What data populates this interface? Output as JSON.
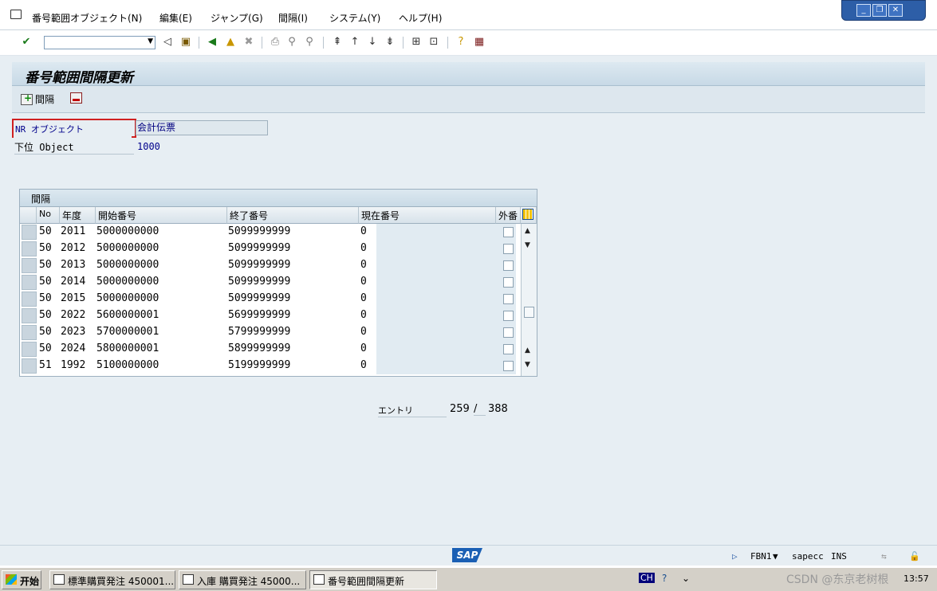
{
  "menubar": {
    "items": [
      "番号範囲オブジェクト(N)",
      "編集(E)",
      "ジャンプ(G)",
      "間隔(I)",
      "システム(Y)",
      "ヘルプ(H)"
    ]
  },
  "toolbar": {
    "command_value": "",
    "icons": [
      "enter-icon",
      "back-icon",
      "save-icon",
      "back-arrow-icon",
      "exit-icon",
      "cancel-icon",
      "print-icon",
      "find-icon",
      "find-next-icon",
      "first-page-icon",
      "prev-page-icon",
      "next-page-icon",
      "last-page-icon",
      "new-session-icon",
      "shortcut-icon",
      "help-icon",
      "layout-icon"
    ]
  },
  "screen": {
    "title": "番号範囲間隔更新",
    "app_button_label": "間隔"
  },
  "fields": {
    "nr_object_label": "NR オブジェクト",
    "nr_object_value": "会計伝票",
    "sub_object_label": "下位 Object",
    "sub_object_value": "1000"
  },
  "table": {
    "title": "間隔",
    "headers": [
      "No",
      "年度",
      "開始番号",
      "終了番号",
      "現在番号",
      "外番"
    ],
    "rows": [
      [
        "50",
        "2011",
        "5000000000",
        "5099999999",
        "0"
      ],
      [
        "50",
        "2012",
        "5000000000",
        "5099999999",
        "0"
      ],
      [
        "50",
        "2013",
        "5000000000",
        "5099999999",
        "0"
      ],
      [
        "50",
        "2014",
        "5000000000",
        "5099999999",
        "0"
      ],
      [
        "50",
        "2015",
        "5000000000",
        "5099999999",
        "0"
      ],
      [
        "50",
        "2022",
        "5600000001",
        "5699999999",
        "0"
      ],
      [
        "50",
        "2023",
        "5700000001",
        "5799999999",
        "0"
      ],
      [
        "50",
        "2024",
        "5800000001",
        "5899999999",
        "0"
      ],
      [
        "51",
        "1992",
        "5100000000",
        "5199999999",
        "0"
      ]
    ]
  },
  "entries": {
    "label": "エントリ",
    "current": "259",
    "separator": "/",
    "total": "388"
  },
  "status": {
    "logo": "SAP",
    "tcode": "FBN1",
    "server": "sapecc",
    "mode": "INS"
  },
  "taskbar": {
    "start": "开始",
    "tasks": [
      "標準購買発注 450001...",
      "入庫 購買発注 45000...",
      "番号範囲間隔更新"
    ],
    "lang": "CH",
    "clock": "13:57",
    "watermark": "CSDN @东京老树根"
  }
}
